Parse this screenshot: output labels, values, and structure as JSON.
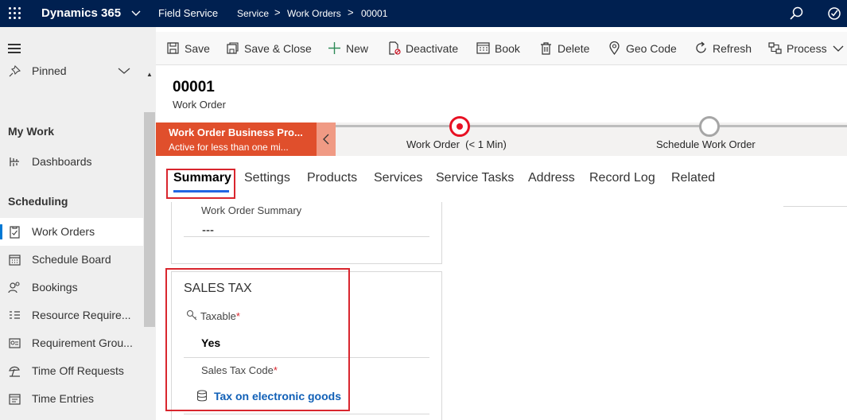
{
  "topbar": {
    "brand": "Dynamics 365",
    "app": "Field Service",
    "breadcrumb": [
      "Service",
      "Work Orders",
      "00001"
    ],
    "search_icon": "search-icon",
    "task_icon": "task-icon"
  },
  "nav": {
    "pinned": "Pinned",
    "groups": [
      {
        "title": "My Work",
        "items": [
          {
            "label": "Dashboards",
            "icon": "dashboard-icon"
          }
        ]
      },
      {
        "title": "Scheduling",
        "items": [
          {
            "label": "Work Orders",
            "icon": "work-order-icon",
            "active": true
          },
          {
            "label": "Schedule Board",
            "icon": "calendar-icon"
          },
          {
            "label": "Bookings",
            "icon": "people-icon"
          },
          {
            "label": "Resource Require...",
            "icon": "list-icon"
          },
          {
            "label": "Requirement Grou...",
            "icon": "group-icon"
          },
          {
            "label": "Time Off Requests",
            "icon": "beach-icon"
          },
          {
            "label": "Time Entries",
            "icon": "clock-icon"
          }
        ]
      }
    ]
  },
  "commands": [
    {
      "label": "Save",
      "icon": "save-icon"
    },
    {
      "label": "Save & Close",
      "icon": "save-close-icon"
    },
    {
      "label": "New",
      "icon": "plus-icon"
    },
    {
      "label": "Deactivate",
      "icon": "deactivate-icon"
    },
    {
      "label": "Book",
      "icon": "book-icon"
    },
    {
      "label": "Delete",
      "icon": "trash-icon"
    },
    {
      "label": "Geo Code",
      "icon": "location-icon"
    },
    {
      "label": "Refresh",
      "icon": "refresh-icon"
    },
    {
      "label": "Process",
      "icon": "process-icon"
    }
  ],
  "record": {
    "title": "00001",
    "entity": "Work Order"
  },
  "bpf": {
    "active_name": "Work Order Business Pro...",
    "active_duration": "Active for less than one mi...",
    "stages": [
      {
        "label": "Work Order",
        "duration": "(< 1 Min)",
        "current": true
      },
      {
        "label": "Schedule Work Order",
        "current": false
      }
    ]
  },
  "tabs": [
    "Summary",
    "Settings",
    "Products",
    "Services",
    "Service Tasks",
    "Address",
    "Record Log",
    "Related"
  ],
  "form": {
    "summary_label": "Work Order Summary",
    "summary_value": "---",
    "sales_tax": {
      "title": "SALES TAX",
      "taxable_label": "Taxable",
      "taxable_value": "Yes",
      "tax_code_label": "Sales Tax Code",
      "tax_code_value": "Tax on electronic goods",
      "required_marker": "*"
    }
  },
  "colors": {
    "topbar": "#002050",
    "accent": "#e04f2c",
    "link": "#1160b7",
    "highlight": "#d9262e"
  }
}
